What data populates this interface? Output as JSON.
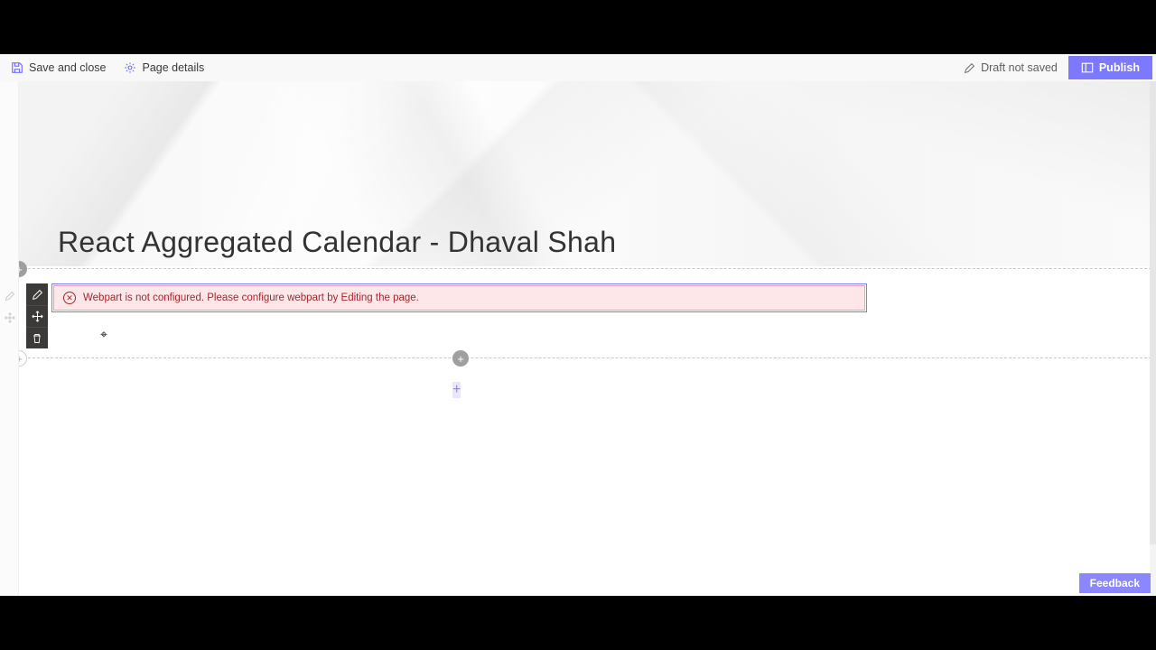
{
  "toolbar": {
    "save_label": "Save and close",
    "details_label": "Page details",
    "status": "Draft not saved",
    "publish_label": "Publish"
  },
  "hero": {
    "title": "React Aggregated Calendar - Dhaval Shah"
  },
  "webpart": {
    "error_message": "Webpart is not configured. Please configure webpart by Editing the page."
  },
  "feedback": {
    "label": "Feedback"
  },
  "icons": {
    "save": "save-icon",
    "gear": "gear-icon",
    "pencil": "pencil-icon",
    "move": "move-icon",
    "trash": "trash-icon",
    "panel": "panel-icon",
    "error": "error-icon",
    "plus": "plus-icon"
  },
  "colors": {
    "accent": "#605cff",
    "error_bg": "#fde7e9",
    "error_text": "#a4262c"
  }
}
